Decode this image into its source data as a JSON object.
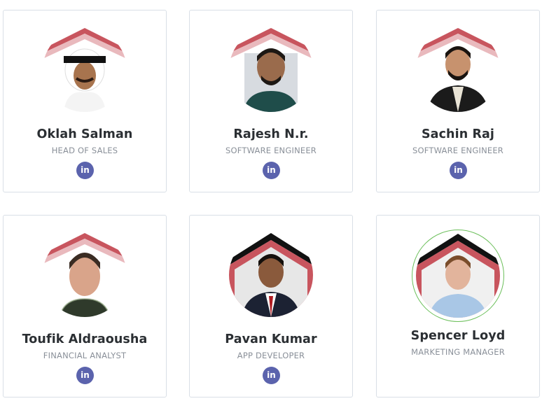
{
  "team": {
    "members": [
      {
        "name": "Oklah Salman",
        "role": "HEAD OF SALES",
        "social": "linkedin-icon"
      },
      {
        "name": "Rajesh N.r.",
        "role": "SOFTWARE ENGINEER",
        "social": "linkedin-icon"
      },
      {
        "name": "Sachin Raj",
        "role": "SOFTWARE ENGINEER",
        "social": "linkedin-icon"
      },
      {
        "name": "Toufik Aldraousha",
        "role": "FINANCIAL ANALYST",
        "social": "linkedin-icon"
      },
      {
        "name": "Pavan Kumar",
        "role": "APP DEVELOPER",
        "social": "linkedin-icon"
      },
      {
        "name": "Spencer Loyd",
        "role": "MARKETING MANAGER"
      }
    ]
  },
  "colors": {
    "linkedin": "#5b63ad",
    "avatar_accent": "#c8555e",
    "featured_ring": "#6bbf5a",
    "name_text": "#2b2f33",
    "role_text": "#8a9099"
  }
}
